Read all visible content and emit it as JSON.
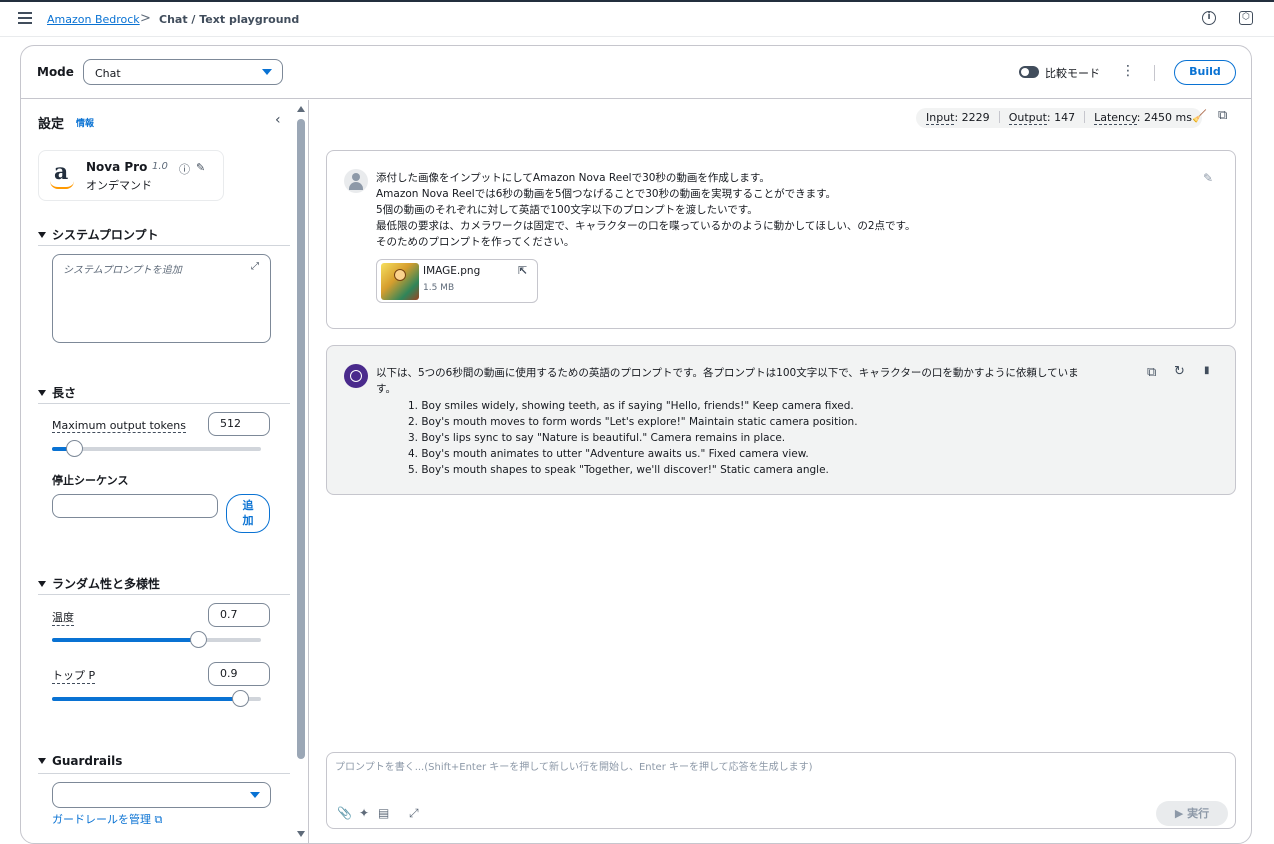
{
  "header": {
    "breadcrumb_link": "Amazon Bedrock",
    "breadcrumb_sep": ">",
    "breadcrumb_current": "Chat / Text playground",
    "info_icon": "i",
    "settings_icon": "⬡"
  },
  "mode_bar": {
    "label": "Mode",
    "mode_value": "Chat",
    "compare_label": "比較モード",
    "kebab": "⋮",
    "build_label": "Build"
  },
  "sidebar": {
    "title": "設定",
    "info": "情報",
    "collapse": "‹",
    "model": {
      "name": "Nova Pro",
      "version": "1.0",
      "sub": "オンデマンド",
      "logo_letter": "a",
      "info_icon": "ⓘ",
      "edit_icon": "✎"
    },
    "system_prompt": {
      "heading": "システムプロンプト",
      "placeholder": "システムプロンプトを追加",
      "expand_icon": "⤢"
    },
    "length": {
      "heading": "長さ",
      "max_tokens_label": "Maximum output tokens",
      "max_tokens_value": "512",
      "max_tokens_slider_fraction": 0.105,
      "stop_sequence_label": "停止シーケンス",
      "add_button": "追加",
      "add_button_line1": "追",
      "add_button_line2": "加"
    },
    "randomness": {
      "heading": "ランダム性と多様性",
      "temperature_label": "温度",
      "temperature_value": "0.7",
      "temperature_fraction": 0.7,
      "top_p_label": "トップ P",
      "top_p_value": "0.9",
      "top_p_fraction": 0.9
    },
    "guardrails": {
      "heading": "Guardrails",
      "select_value": "",
      "manage_link": "ガードレールを管理",
      "ext_icon": "⧉"
    }
  },
  "metrics": {
    "input_key": "Input",
    "input_value": ": 2229",
    "output_key": "Output",
    "output_value": ": 147",
    "latency_key": "Latency",
    "latency_value": ": 2450 ms",
    "broom_icon": "🧹",
    "copy_icon": "⧉"
  },
  "messages": {
    "user": {
      "lines": [
        "添付した画像をインプットにしてAmazon Nova Reelで30秒の動画を作成します。",
        "Amazon Nova Reelでは6秒の動画を5個つなげることで30秒の動画を実現することができます。",
        "5個の動画のそれぞれに対して英語で100文字以下のプロンプトを渡したいです。",
        "最低限の要求は、カメラワークは固定で、キャラクターの口を喋っているかのように動かしてほしい、の2点です。",
        "そのためのプロンプトを作ってください。"
      ],
      "attachment_name": "IMAGE.png",
      "attachment_size": "1.5 MB",
      "edit_icon": "✎",
      "open_icon": "⇱"
    },
    "assistant": {
      "intro_line1": "以下は、5つの6秒間の動画に使用するための英語のプロンプトです。各プロンプトは100文字以下で、キャラクターの口を動かすように依頼していま",
      "intro_line2": "す。",
      "items": [
        "1. Boy smiles widely, showing teeth, as if saying \"Hello, friends!\" Keep camera fixed.",
        "2. Boy's mouth moves to form words \"Let's explore!\" Maintain static camera position.",
        "3. Boy's lips sync to say \"Nature is beautiful.\" Camera remains in place.",
        "4. Boy's mouth animates to utter \"Adventure awaits us.\" Fixed camera view.",
        "5. Boy's mouth shapes to speak \"Together, we'll discover!\" Static camera angle."
      ],
      "copy_icon": "⧉",
      "retry_icon": "↻",
      "stats_icon": "▮"
    }
  },
  "prompt": {
    "placeholder": "プロンプトを書く...(Shift+Enter キーを押して新しい行を開始し、Enter キーを押して応答を生成します)",
    "attach_icon": "📎",
    "magic_icon": "✦",
    "doc_icon": "▤",
    "expand_icon": "⤢",
    "run_label": "▶ 実行"
  }
}
